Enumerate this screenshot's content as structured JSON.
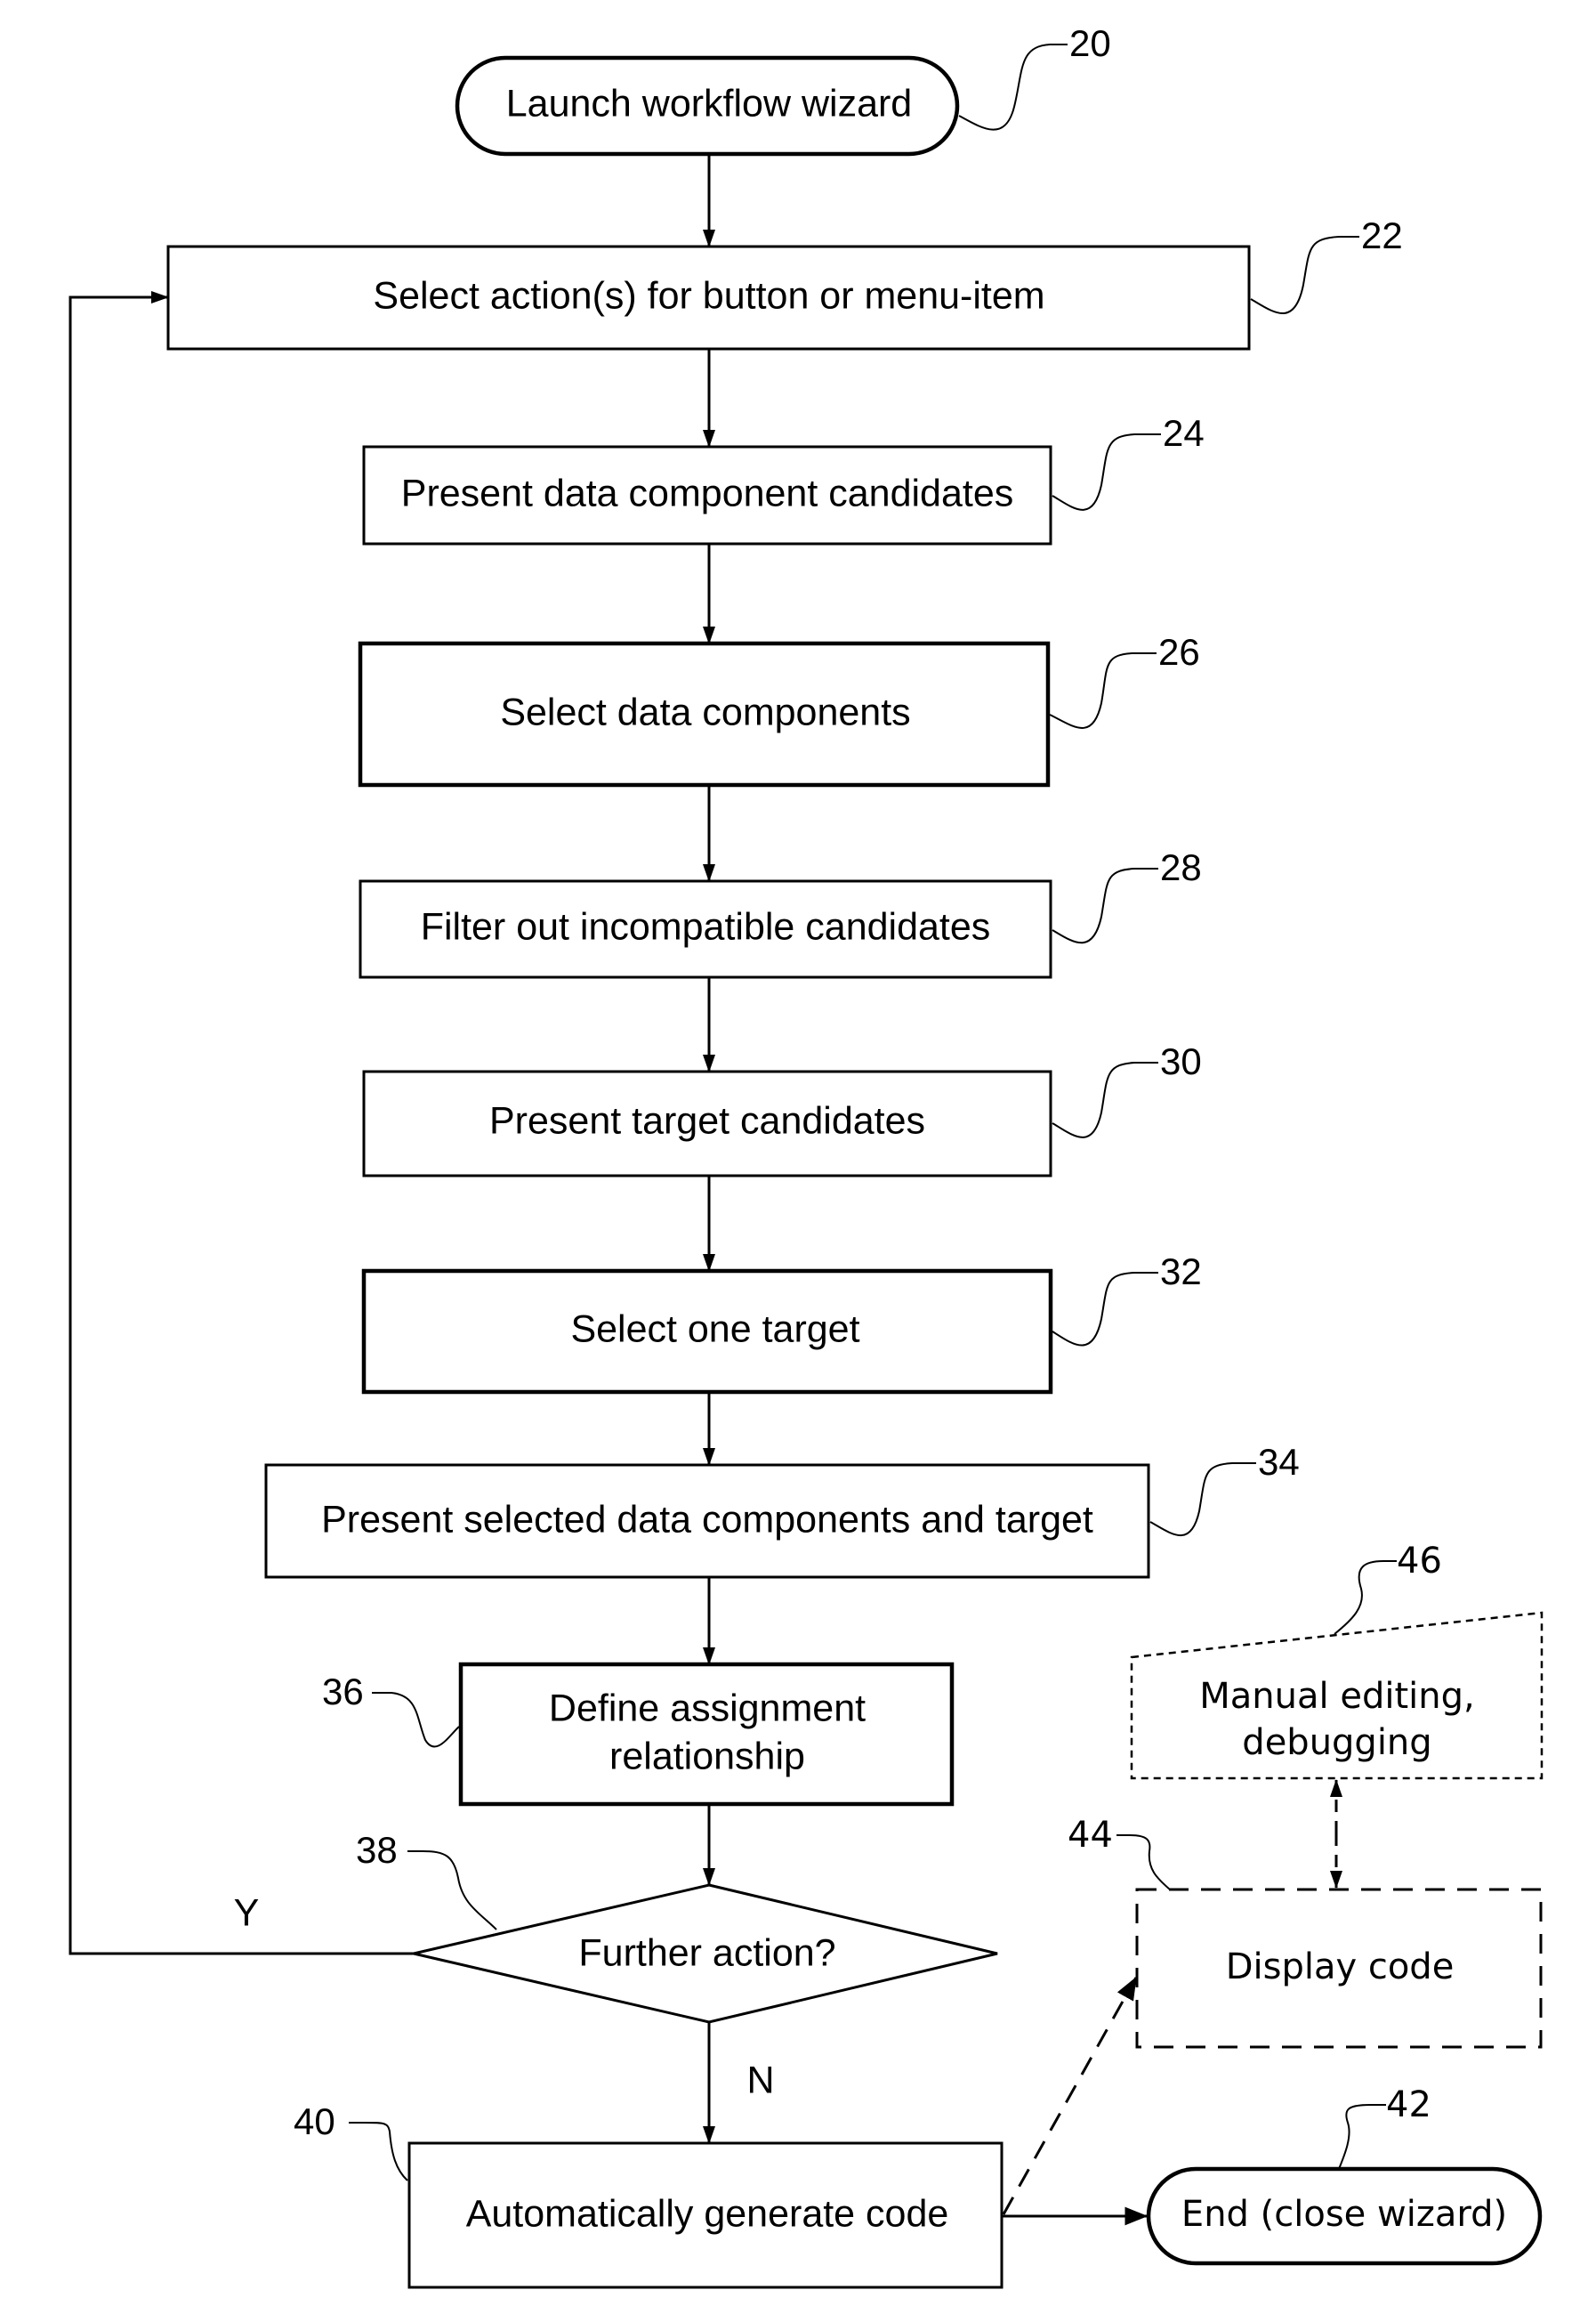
{
  "figure": {
    "type": "flowchart",
    "nodes": {
      "launch": {
        "ref": "20",
        "label": "Launch workflow wizard",
        "shape": "terminator"
      },
      "select_actions": {
        "ref": "22",
        "label": "Select action(s) for button or menu-item",
        "shape": "process"
      },
      "present_data_candidates": {
        "ref": "24",
        "label": "Present data component candidates",
        "shape": "process"
      },
      "select_data_components": {
        "ref": "26",
        "label": "Select data components",
        "shape": "process"
      },
      "filter_incompatible": {
        "ref": "28",
        "label": "Filter out incompatible candidates",
        "shape": "process"
      },
      "present_target_candidates": {
        "ref": "30",
        "label": "Present target candidates",
        "shape": "process"
      },
      "select_one_target": {
        "ref": "32",
        "label": "Select one target",
        "shape": "process"
      },
      "present_selected": {
        "ref": "34",
        "label": "Present selected data components and target",
        "shape": "process"
      },
      "define_assignment": {
        "ref": "36",
        "label_line1": "Define assignment",
        "label_line2": "relationship",
        "shape": "process"
      },
      "further_action": {
        "ref": "38",
        "label": "Further action?",
        "shape": "decision"
      },
      "auto_generate": {
        "ref": "40",
        "label": "Automatically generate code",
        "shape": "process"
      },
      "end": {
        "ref": "42",
        "label": "End (close wizard)",
        "shape": "terminator"
      },
      "display_code": {
        "ref": "44",
        "label": "Display code",
        "shape": "optional-process"
      },
      "manual_editing": {
        "ref": "46",
        "label_line1": "Manual editing,",
        "label_line2": "debugging",
        "shape": "manual-input"
      }
    },
    "edges": [
      {
        "from": "launch",
        "to": "select_actions"
      },
      {
        "from": "select_actions",
        "to": "present_data_candidates"
      },
      {
        "from": "present_data_candidates",
        "to": "select_data_components"
      },
      {
        "from": "select_data_components",
        "to": "filter_incompatible"
      },
      {
        "from": "filter_incompatible",
        "to": "present_target_candidates"
      },
      {
        "from": "present_target_candidates",
        "to": "select_one_target"
      },
      {
        "from": "select_one_target",
        "to": "present_selected"
      },
      {
        "from": "present_selected",
        "to": "define_assignment"
      },
      {
        "from": "define_assignment",
        "to": "further_action"
      },
      {
        "from": "further_action",
        "to": "select_actions",
        "label": "Y"
      },
      {
        "from": "further_action",
        "to": "auto_generate",
        "label": "N"
      },
      {
        "from": "auto_generate",
        "to": "end"
      },
      {
        "from": "auto_generate",
        "to": "display_code",
        "style": "dashed"
      },
      {
        "from": "display_code",
        "to": "manual_editing",
        "style": "dashed",
        "bidirectional": true
      }
    ],
    "branch_labels": {
      "yes": "Y",
      "no": "N"
    }
  }
}
